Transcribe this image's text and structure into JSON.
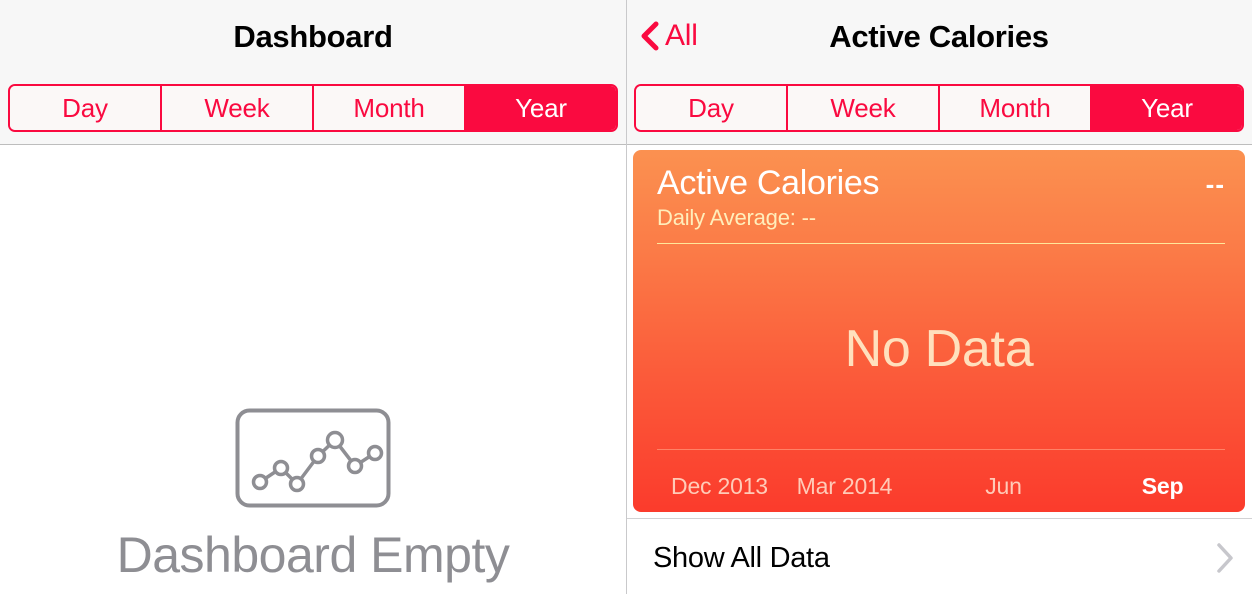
{
  "left_panel": {
    "navbar": {
      "title": "Dashboard"
    },
    "segmented_control": {
      "options": [
        "Day",
        "Week",
        "Month",
        "Year"
      ],
      "selected": "Year"
    },
    "empty_state": {
      "icon": "line-chart-icon",
      "label": "Dashboard Empty"
    }
  },
  "right_panel": {
    "navbar": {
      "back_label": "All",
      "back_icon": "chevron-left-icon",
      "title": "Active Calories"
    },
    "segmented_control": {
      "options": [
        "Day",
        "Week",
        "Month",
        "Year"
      ],
      "selected": "Year"
    },
    "chart_card": {
      "title": "Active Calories",
      "value": "--",
      "subtitle": "Daily Average: --",
      "empty_message": "No Data",
      "accent_top": "#fb9150",
      "accent_bottom": "#fb3b2c",
      "rule_color": "#ffe79a",
      "subtitle_color": "#ffeebb",
      "empty_message_color": "#ffe0bd"
    },
    "show_all_data": {
      "label": "Show All Data",
      "chevron_icon": "chevron-right-icon"
    }
  },
  "chart_data": {
    "type": "line",
    "title": "Active Calories",
    "subtitle": "Daily Average: --",
    "xlabel": "",
    "ylabel": "",
    "categories": [
      "Dec 2013",
      "Mar 2014",
      "Jun",
      "Sep"
    ],
    "tick_positions_pct": [
      11,
      33,
      61,
      89
    ],
    "current_tick": "Sep",
    "series": [
      {
        "name": "Active Calories",
        "values": []
      }
    ],
    "empty": true,
    "empty_message": "No Data",
    "grid": false,
    "legend": "none",
    "range": "Year"
  },
  "theme": {
    "tint": "#fa0a40",
    "navbar_bg": "#f7f7f7",
    "muted_text": "#8e8e93"
  }
}
